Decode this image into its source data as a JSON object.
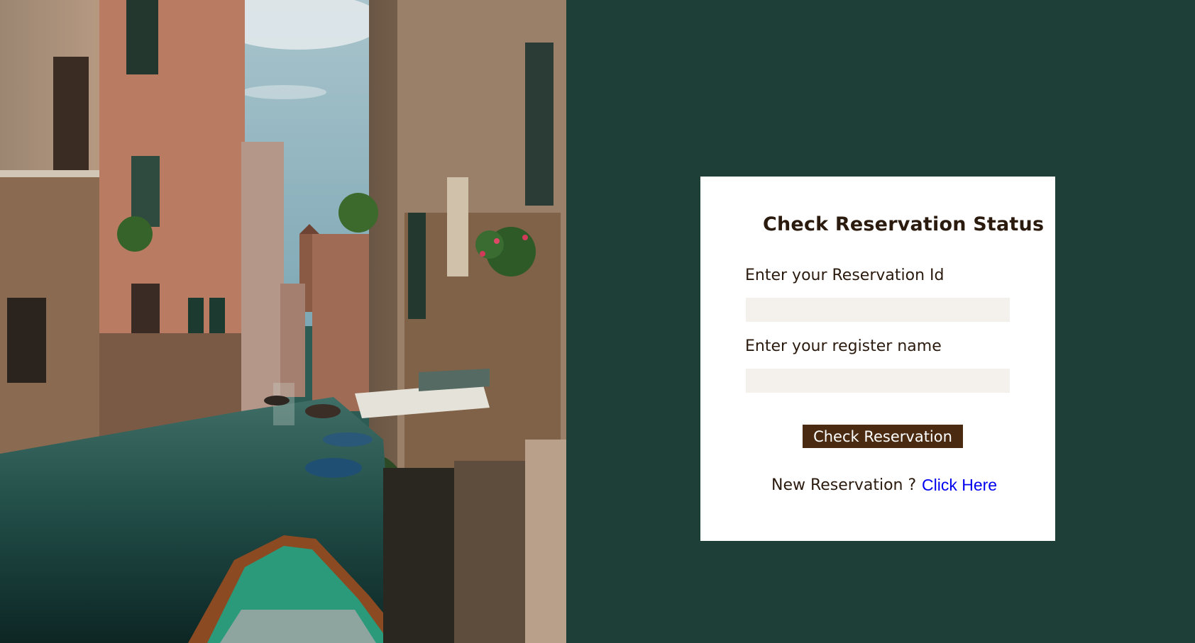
{
  "form": {
    "title": "Check Reservation Status",
    "reservation_id_label": "Enter your Reservation Id",
    "reservation_id_value": "",
    "register_name_label": "Enter your register name",
    "register_name_value": "",
    "submit_label": "Check Reservation",
    "new_reservation_prompt": "New Reservation ?",
    "new_reservation_link": "Click Here"
  },
  "colors": {
    "background": "#1e3f37",
    "card": "#ffffff",
    "button": "#4a2a10",
    "input": "#f4f0ec",
    "link": "#0000ee"
  }
}
